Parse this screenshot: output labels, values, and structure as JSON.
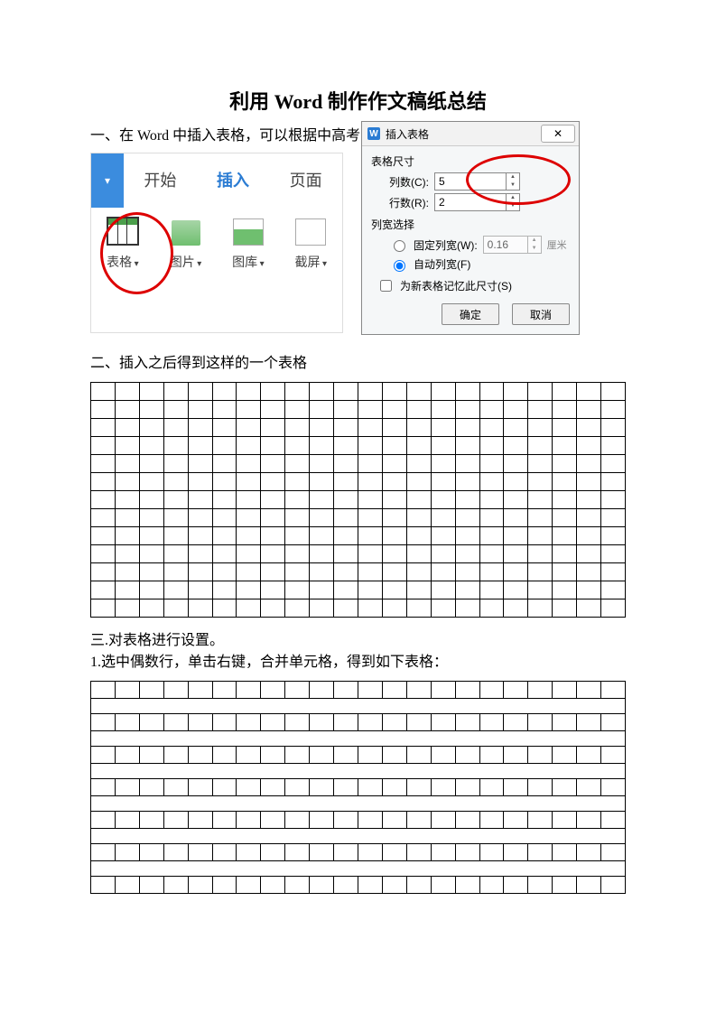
{
  "title": "利用 Word 制作作文稿纸总结",
  "section1": "一、在 Word 中插入表格，可以根据中高考的作文答题卡的列数设定",
  "ribbon": {
    "tab_start": "开始",
    "tab_insert": "插入",
    "tab_page": "页面",
    "btn_table": "表格",
    "btn_picture": "图片",
    "btn_gallery": "图库",
    "btn_screenshot": "截屏"
  },
  "dialog": {
    "title": "插入表格",
    "close": "✕",
    "group_size": "表格尺寸",
    "label_cols": "列数(C):",
    "value_cols": "5",
    "label_rows": "行数(R):",
    "value_rows": "2",
    "group_width": "列宽选择",
    "radio_fixed": "固定列宽(W):",
    "value_fixed": "0.16",
    "unit_fixed": "厘米",
    "radio_auto": "自动列宽(F)",
    "check_remember": "为新表格记忆此尺寸(S)",
    "btn_ok": "确定",
    "btn_cancel": "取消"
  },
  "section2": "二、插入之后得到这样的一个表格",
  "table1": {
    "rows": 13,
    "cols": 22
  },
  "section3a": "三.对表格进行设置。",
  "section3b": "1.选中偶数行，单击右键，合并单元格，得到如下表格：",
  "table2": {
    "row_pairs": 7,
    "cols": 22
  }
}
